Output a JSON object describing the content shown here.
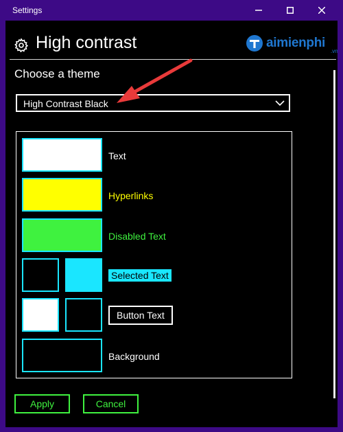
{
  "window": {
    "title": "Settings",
    "controls": [
      "minimize-icon",
      "maximize-icon",
      "close-icon"
    ]
  },
  "header": {
    "icon": "gear-icon",
    "title": "High contrast"
  },
  "watermark": {
    "brand": "aimienphi",
    "suffix": ".vn",
    "logo": "T-logo-icon"
  },
  "theme": {
    "section_title": "Choose a theme",
    "selected": "High Contrast Black",
    "chevron": "chevron-down-icon"
  },
  "colors": {
    "window_border": "#3d0a86",
    "background": "#000000",
    "text": "#ffffff",
    "hyperlink": "#ffff00",
    "disabled": "#3ff23f",
    "selected_bg": "#1ae6ff",
    "annotation_arrow": "#e83a3a"
  },
  "color_rows": [
    {
      "label": "Text",
      "swatches": [
        "#ffffff"
      ]
    },
    {
      "label": "Hyperlinks",
      "swatches": [
        "#ffff00"
      ]
    },
    {
      "label": "Disabled Text",
      "swatches": [
        "#3ff23f"
      ]
    },
    {
      "label": "Selected Text",
      "swatches": [
        "#000000",
        "#1ae6ff"
      ]
    },
    {
      "label": "Button Text",
      "swatches": [
        "#ffffff",
        "#000000"
      ]
    },
    {
      "label": "Background",
      "swatches": [
        "#000000"
      ]
    }
  ],
  "actions": {
    "apply_label": "Apply",
    "cancel_label": "Cancel"
  }
}
